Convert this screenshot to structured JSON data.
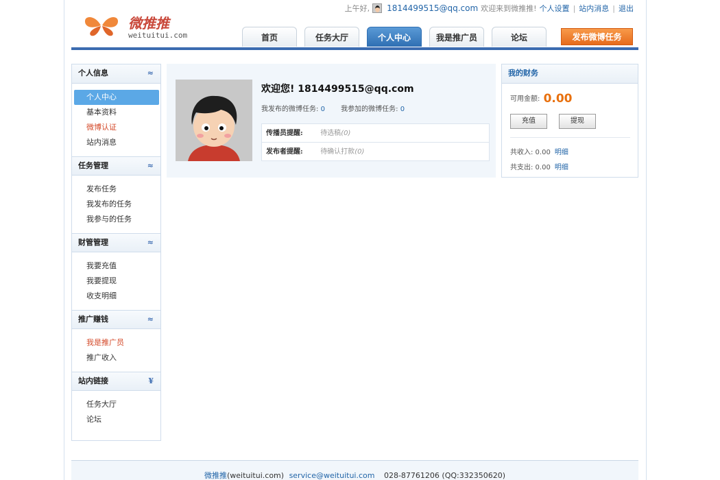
{
  "logo": {
    "cn": "微推推",
    "en": "weituitui.com"
  },
  "topbar": {
    "greeting": "上午好,",
    "email": "1814499515@qq.com",
    "welcome": "欢迎来到微推推!",
    "links": [
      "个人设置",
      "站内消息",
      "退出"
    ]
  },
  "nav": {
    "tabs": [
      "首页",
      "任务大厅",
      "个人中心",
      "我是推广员",
      "论坛"
    ],
    "active": "个人中心",
    "publish": "发布微博任务"
  },
  "sidebar": {
    "sections": [
      {
        "title": "个人信息",
        "chevron": "up",
        "items": [
          "个人中心",
          "基本资料",
          "微博认证",
          "站内消息"
        ]
      },
      {
        "title": "任务管理",
        "chevron": "up",
        "items": [
          "发布任务",
          "我发布的任务",
          "我参与的任务"
        ]
      },
      {
        "title": "财管管理",
        "chevron": "up",
        "items": [
          "我要充值",
          "我要提现",
          "收支明细"
        ]
      },
      {
        "title": "推广赚钱",
        "chevron": "up",
        "items": [
          "我是推广员",
          "推广收入"
        ]
      },
      {
        "title": "站内链接",
        "chevron": "down",
        "items": [
          "任务大厅",
          "论坛"
        ]
      }
    ]
  },
  "profile": {
    "welcome": "欢迎您! 1814499515@qq.com",
    "published_label": "我发布的微博任务:",
    "published_count": "0",
    "joined_label": "我参加的微博任务:",
    "joined_count": "0",
    "remind": [
      {
        "label": "传播员提醒:",
        "text": "待选稿",
        "count": "(0)"
      },
      {
        "label": "发布者提醒:",
        "text": "待确认打款",
        "count": "(0)"
      }
    ]
  },
  "finance": {
    "title": "我的财务",
    "balance_label": "可用金额:",
    "balance": "0.00",
    "recharge": "充值",
    "withdraw": "提现",
    "income_label": "共收入: 0.00",
    "expense_label": "共支出: 0.00",
    "detail": "明细"
  },
  "footer": {
    "site": "微推推",
    "domain": "(weituitui.com)",
    "email": "service@weituitui.com",
    "contact": "028-87761206 (QQ:332350620)"
  },
  "colors": {
    "accent": "#3b6bb0",
    "orange": "#e8700e",
    "active_item": "#5ba8e6"
  }
}
